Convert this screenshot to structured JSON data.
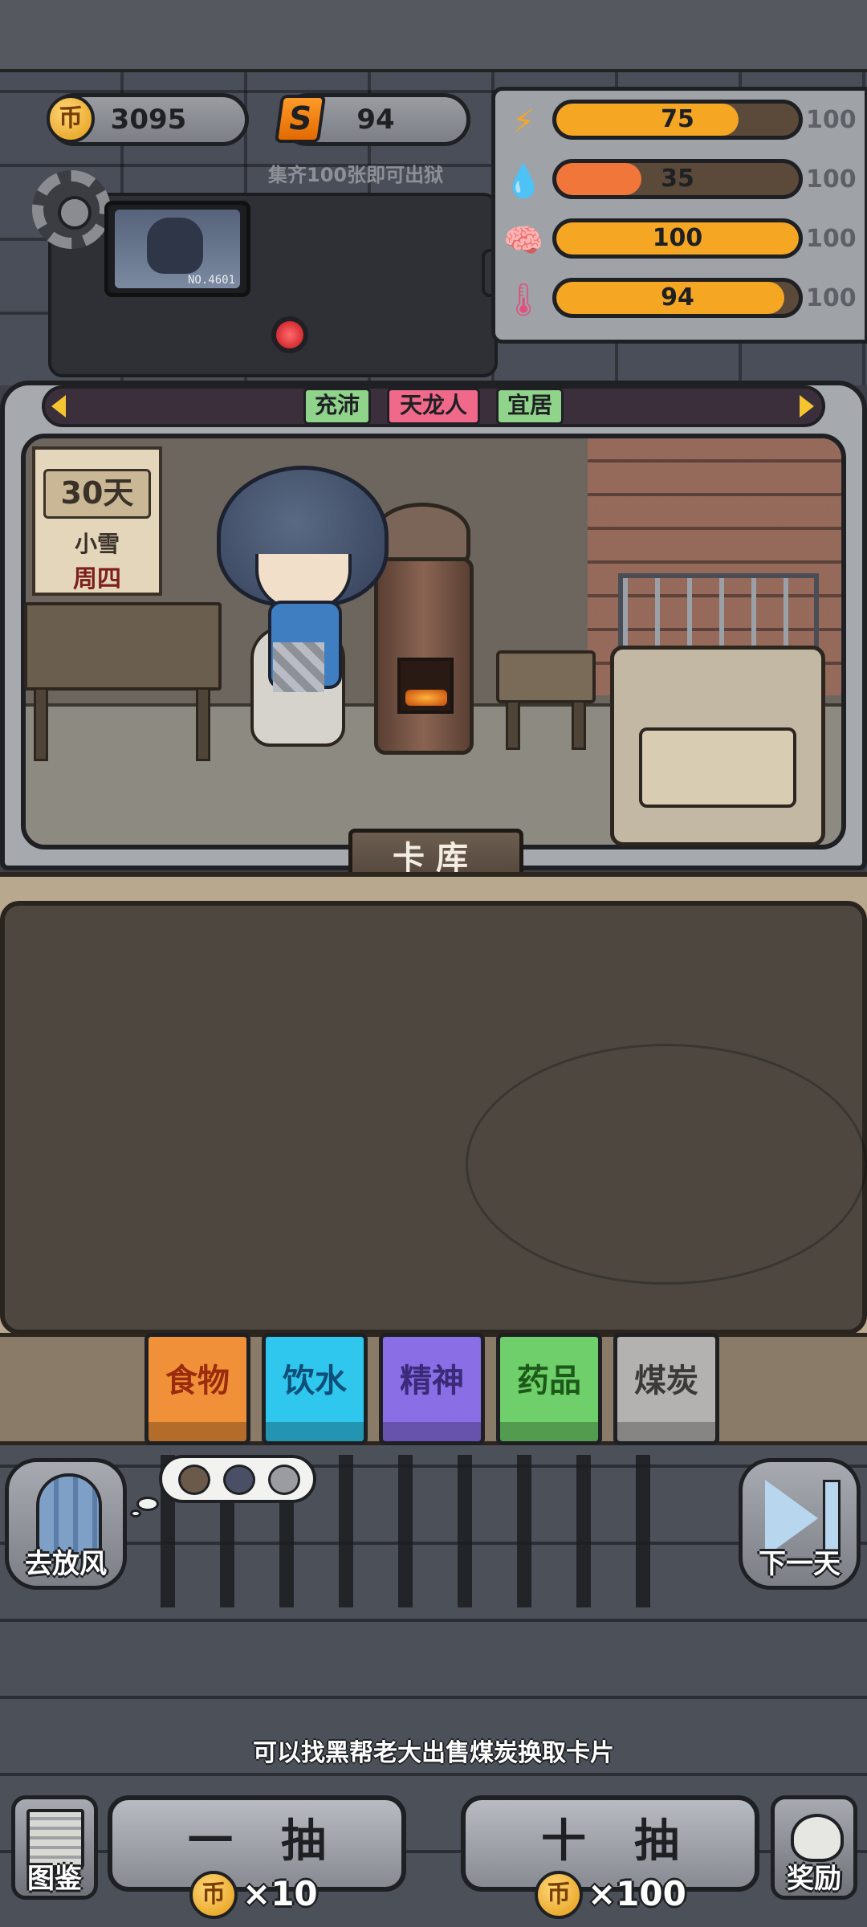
{
  "currency": {
    "coins": "3095",
    "coin_icon": "币",
    "s_currency": "94",
    "s_icon": "S"
  },
  "hint_top": "集齐100张即可出狱",
  "monitor_no": "NO.4601",
  "stats": [
    {
      "icon": "lightning-icon",
      "symbol": "⚡",
      "value": "75",
      "max": "100",
      "fill_pct": 75,
      "color": "#f5a623"
    },
    {
      "icon": "water-drop-icon",
      "symbol": "💧",
      "value": "35",
      "max": "100",
      "fill_pct": 35,
      "color": "#f0763a"
    },
    {
      "icon": "brain-icon",
      "symbol": "🧠",
      "value": "100",
      "max": "100",
      "fill_pct": 100,
      "color": "#f5a623"
    },
    {
      "icon": "thermometer-icon",
      "symbol": "🌡",
      "value": "94",
      "max": "100",
      "fill_pct": 94,
      "color": "#f5a623"
    }
  ],
  "tags": [
    {
      "label": "充沛",
      "color": "#8fd48a"
    },
    {
      "label": "天龙人",
      "color": "#f0698a"
    },
    {
      "label": "宜居",
      "color": "#8fd48a"
    }
  ],
  "calendar": {
    "days": "30天",
    "weather": "小雪",
    "weekday": "周四"
  },
  "card_library_label": "卡库",
  "categories": [
    {
      "label": "食物",
      "bg": "#f0913a",
      "text": "#9a2b0c"
    },
    {
      "label": "饮水",
      "bg": "#2fc7ee",
      "text": "#0c4f78"
    },
    {
      "label": "精神",
      "bg": "#8a6ee6",
      "text": "#3a2a78"
    },
    {
      "label": "药品",
      "bg": "#6fcf6a",
      "text": "#1d5a1a"
    },
    {
      "label": "煤炭",
      "bg": "#b4b2b0",
      "text": "#3a3a3a"
    }
  ],
  "side_buttons": {
    "left": "去放风",
    "right": "下一天"
  },
  "tip": "可以找黑帮老大出售煤炭换取卡片",
  "draw": {
    "single_label": "一抽",
    "single_cost": "×10",
    "ten_label": "十抽",
    "ten_cost": "×100"
  },
  "corner": {
    "collection": "图鉴",
    "reward": "奖励"
  }
}
